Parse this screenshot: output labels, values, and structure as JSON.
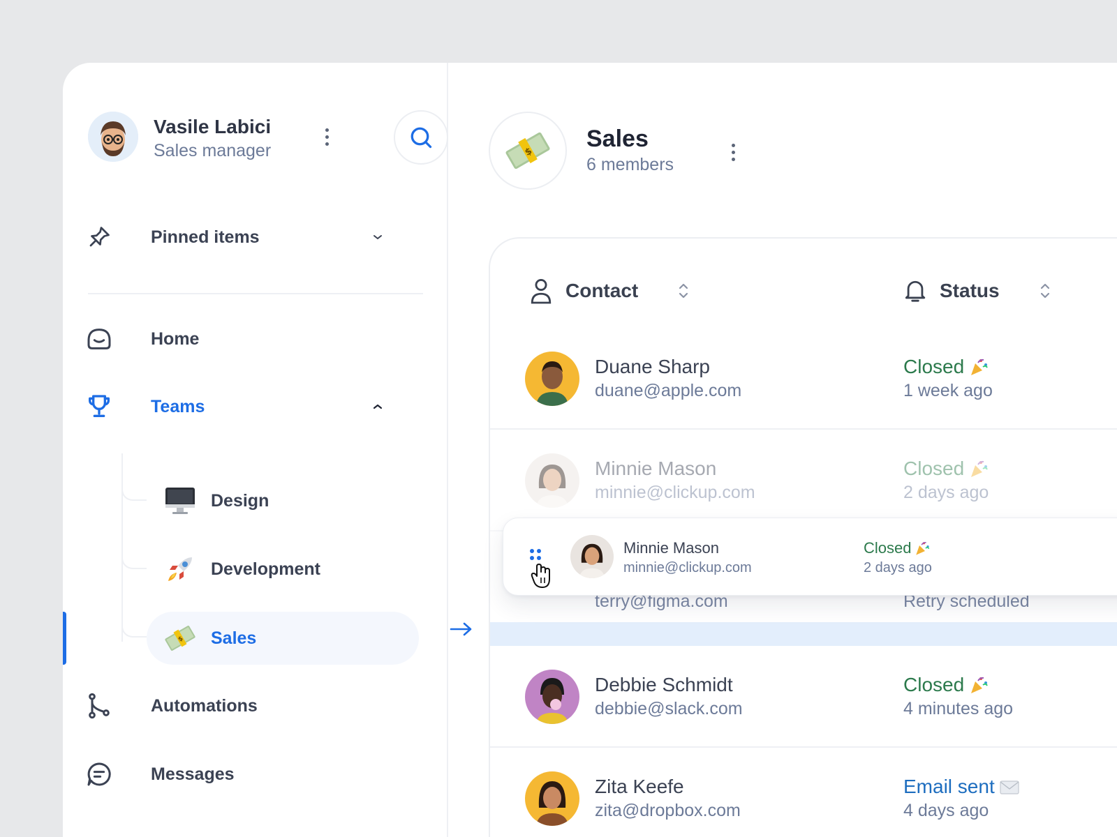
{
  "profile": {
    "name": "Vasile Labici",
    "role": "Sales manager"
  },
  "nav": {
    "pinned_label": "Pinned items",
    "home_label": "Home",
    "teams_label": "Teams",
    "automations_label": "Automations",
    "messages_label": "Messages",
    "teams_children": [
      {
        "label": "Design",
        "icon": "desktop-computer-icon"
      },
      {
        "label": "Development",
        "icon": "rocket-icon"
      },
      {
        "label": "Sales",
        "icon": "money-icon"
      }
    ]
  },
  "team": {
    "title": "Sales",
    "members": "6 members"
  },
  "table": {
    "columns": {
      "contact": "Contact",
      "status": "Status"
    },
    "rows": [
      {
        "name": "Duane Sharp",
        "email": "duane@apple.com",
        "status": "Closed",
        "when": "1 week ago",
        "avatar_bg": "#f5b833"
      },
      {
        "name": "Minnie Mason",
        "email": "minnie@clickup.com",
        "status": "Closed",
        "when": "2 days ago",
        "avatar_bg": "#e9e4e0"
      },
      {
        "name": "Debbie Schmidt",
        "email": "debbie@slack.com",
        "status": "Closed",
        "when": "4 minutes ago",
        "avatar_bg": "#c084c5"
      },
      {
        "name": "Zita Keefe",
        "email": "zita@dropbox.com",
        "status": "Email sent",
        "when": "4 days ago",
        "avatar_bg": "#f5b833"
      }
    ],
    "hidden_row": {
      "email": "terry@figma.com",
      "when": "Retry scheduled"
    },
    "dragging": {
      "name": "Minnie Mason",
      "email": "minnie@clickup.com",
      "status": "Closed",
      "when": "2 days ago"
    }
  },
  "colors": {
    "accent": "#1d6de5",
    "closed": "#2c7a4c",
    "sent": "#1d6dbf",
    "muted": "#6c7a98"
  }
}
